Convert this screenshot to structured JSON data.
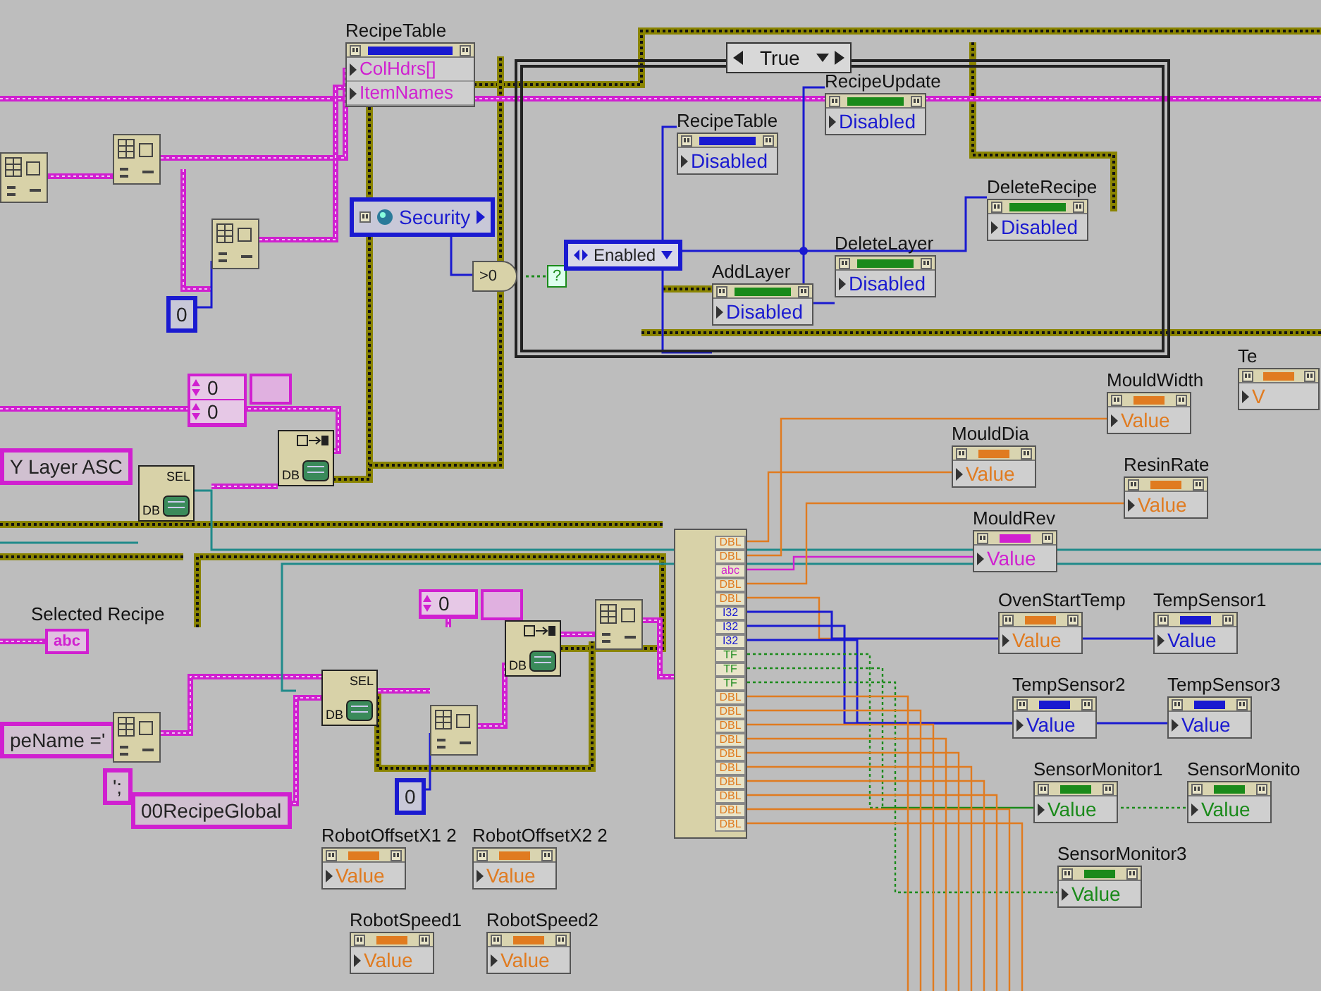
{
  "recipe_table_node": {
    "label": "RecipeTable",
    "color": "#1a1ad0",
    "properties": [
      "ColHdrs[]",
      "ItemNames"
    ]
  },
  "security": {
    "label": "Security",
    "comparison": ">0",
    "selector_terminal": "?"
  },
  "case_structure": {
    "selector": "True",
    "enum_constant": "Enabled",
    "property_nodes": [
      {
        "label": "RecipeTable",
        "property": "Disabled",
        "color": "#1a1ad0"
      },
      {
        "label": "RecipeUpdate",
        "property": "Disabled",
        "color": "#1a8a1a"
      },
      {
        "label": "DeleteRecipe",
        "property": "Disabled",
        "color": "#1a8a1a"
      },
      {
        "label": "AddLayer",
        "property": "Disabled",
        "color": "#1a8a1a"
      },
      {
        "label": "DeleteLayer",
        "property": "Disabled",
        "color": "#1a8a1a"
      }
    ]
  },
  "numeric_constants": [
    "0",
    "0"
  ],
  "array_constants": [
    {
      "values": [
        "0",
        "0"
      ]
    },
    {
      "values": [
        "0"
      ]
    }
  ],
  "string_constants": [
    "Y Layer ASC",
    "peName ='",
    "';",
    "00RecipeGlobal"
  ],
  "selected_recipe": {
    "label": "Selected Recipe",
    "type_label": "abc"
  },
  "db_nodes": [
    {
      "kind": "select",
      "tag": "SEL",
      "db": "DB"
    },
    {
      "kind": "fetch",
      "db": "DB"
    },
    {
      "kind": "select",
      "tag": "SEL",
      "db": "DB"
    },
    {
      "kind": "fetch",
      "db": "DB"
    }
  ],
  "unbundle_terminals": [
    {
      "type": "DBL",
      "color": "#e07b20"
    },
    {
      "type": "DBL",
      "color": "#e07b20"
    },
    {
      "type": "abc",
      "color": "#d020d0"
    },
    {
      "type": "DBL",
      "color": "#e07b20"
    },
    {
      "type": "DBL",
      "color": "#e07b20"
    },
    {
      "type": "I32",
      "color": "#1a1ad0"
    },
    {
      "type": "I32",
      "color": "#1a1ad0"
    },
    {
      "type": "I32",
      "color": "#1a1ad0"
    },
    {
      "type": "TF",
      "color": "#1a8a1a"
    },
    {
      "type": "TF",
      "color": "#1a8a1a"
    },
    {
      "type": "TF",
      "color": "#1a8a1a"
    },
    {
      "type": "DBL",
      "color": "#e07b20"
    },
    {
      "type": "DBL",
      "color": "#e07b20"
    },
    {
      "type": "DBL",
      "color": "#e07b20"
    },
    {
      "type": "DBL",
      "color": "#e07b20"
    },
    {
      "type": "DBL",
      "color": "#e07b20"
    },
    {
      "type": "DBL",
      "color": "#e07b20"
    },
    {
      "type": "DBL",
      "color": "#e07b20"
    },
    {
      "type": "DBL",
      "color": "#e07b20"
    },
    {
      "type": "DBL",
      "color": "#e07b20"
    },
    {
      "type": "DBL",
      "color": "#e07b20"
    }
  ],
  "indicators": [
    {
      "label": "MouldDia",
      "value": "Value",
      "color": "#e07b20"
    },
    {
      "label": "MouldWidth",
      "value": "Value",
      "color": "#e07b20"
    },
    {
      "label": "MouldRev",
      "value": "Value",
      "color": "#d020d0"
    },
    {
      "label": "ResinRate",
      "value": "Value",
      "color": "#e07b20"
    },
    {
      "label": "OvenStartTemp",
      "value": "Value",
      "color": "#e07b20"
    },
    {
      "label": "TempSensor1",
      "value": "Value",
      "color": "#1a1ad0"
    },
    {
      "label": "TempSensor2",
      "value": "Value",
      "color": "#1a1ad0"
    },
    {
      "label": "TempSensor3",
      "value": "Value",
      "color": "#1a1ad0"
    },
    {
      "label": "SensorMonitor1",
      "value": "Value",
      "color": "#1a8a1a"
    },
    {
      "label": "SensorMonito",
      "value": "Value",
      "color": "#1a8a1a"
    },
    {
      "label": "SensorMonitor3",
      "value": "Value",
      "color": "#1a8a1a"
    },
    {
      "label": "RobotOffsetX1 2",
      "value": "Value",
      "color": "#e07b20"
    },
    {
      "label": "RobotOffsetX2 2",
      "value": "Value",
      "color": "#e07b20"
    },
    {
      "label": "RobotSpeed1",
      "value": "Value",
      "color": "#e07b20"
    },
    {
      "label": "RobotSpeed2",
      "value": "Value",
      "color": "#e07b20"
    },
    {
      "label": "Te",
      "value": "V",
      "color": "#e07b20"
    }
  ]
}
